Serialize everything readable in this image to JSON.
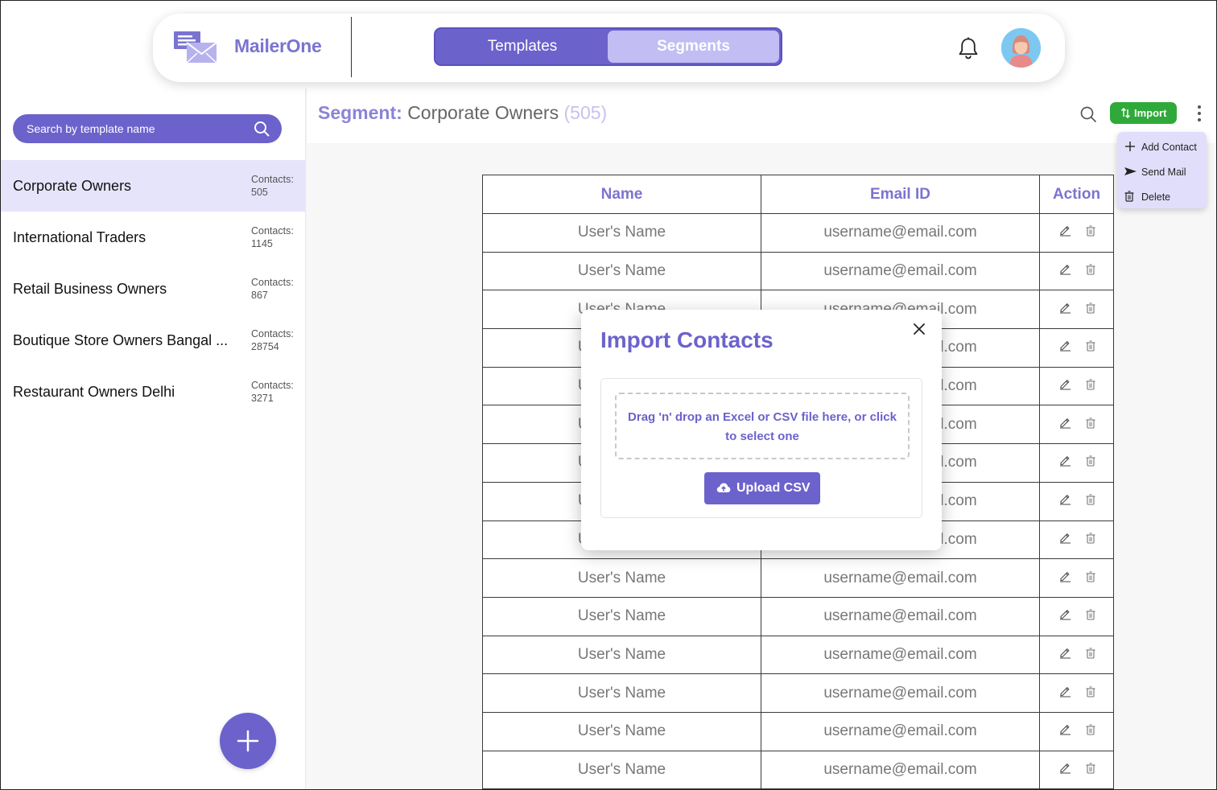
{
  "app": {
    "brand": "MailerOne"
  },
  "nav": {
    "tabs": [
      {
        "label": "Templates"
      },
      {
        "label": "Segments",
        "active": true
      }
    ]
  },
  "icons": {
    "notifications": "bell-icon",
    "avatar": "user-avatar",
    "search": "search-icon",
    "add": "plus-icon",
    "more": "kebab-icon"
  },
  "sidebar": {
    "search_placeholder": "Search by template name",
    "segments": [
      {
        "name": "Corporate Owners",
        "contacts_label": "Contacts:",
        "count": "505",
        "active": true
      },
      {
        "name": "International Traders",
        "contacts_label": "Contacts:",
        "count": "1145"
      },
      {
        "name": "Retail Business Owners",
        "contacts_label": "Contacts:",
        "count": "867"
      },
      {
        "name": "Boutique Store Owners Bangal ...",
        "contacts_label": "Contacts:",
        "count": "28754"
      },
      {
        "name": "Restaurant Owners Delhi",
        "contacts_label": "Contacts:",
        "count": "3271"
      }
    ]
  },
  "main": {
    "title_label": "Segment:",
    "title_name": "Corporate Owners",
    "title_count": "(505)",
    "import_label": "Import",
    "menu": [
      {
        "label": "Add Contact"
      },
      {
        "label": "Send Mail"
      },
      {
        "label": "Delete"
      }
    ]
  },
  "table": {
    "headers": {
      "name": "Name",
      "email": "Email ID",
      "action": "Action"
    },
    "rows": [
      {
        "name": "User's Name",
        "email": "username@email.com"
      },
      {
        "name": "User's Name",
        "email": "username@email.com"
      },
      {
        "name": "User's Name",
        "email": "username@email.com"
      },
      {
        "name": "User's Name",
        "email": "username@email.com"
      },
      {
        "name": "User's Name",
        "email": "username@email.com"
      },
      {
        "name": "User's Name",
        "email": "username@email.com"
      },
      {
        "name": "User's Name",
        "email": "username@email.com"
      },
      {
        "name": "User's Name",
        "email": "username@email.com"
      },
      {
        "name": "User's Name",
        "email": "username@email.com"
      },
      {
        "name": "User's Name",
        "email": "username@email.com"
      },
      {
        "name": "User's Name",
        "email": "username@email.com"
      },
      {
        "name": "User's Name",
        "email": "username@email.com"
      },
      {
        "name": "User's Name",
        "email": "username@email.com"
      },
      {
        "name": "User's Name",
        "email": "username@email.com"
      },
      {
        "name": "User's Name",
        "email": "username@email.com"
      }
    ]
  },
  "modal": {
    "title": "Import Contacts",
    "drop_text": "Drag 'n' drop an Excel or CSV file here, or click to select one",
    "upload_label": "Upload CSV"
  },
  "colors": {
    "accent": "#6c62cc",
    "accent_light": "#c2bdf3",
    "import_green": "#2fa93a",
    "selected_row": "#e6e4fb"
  }
}
